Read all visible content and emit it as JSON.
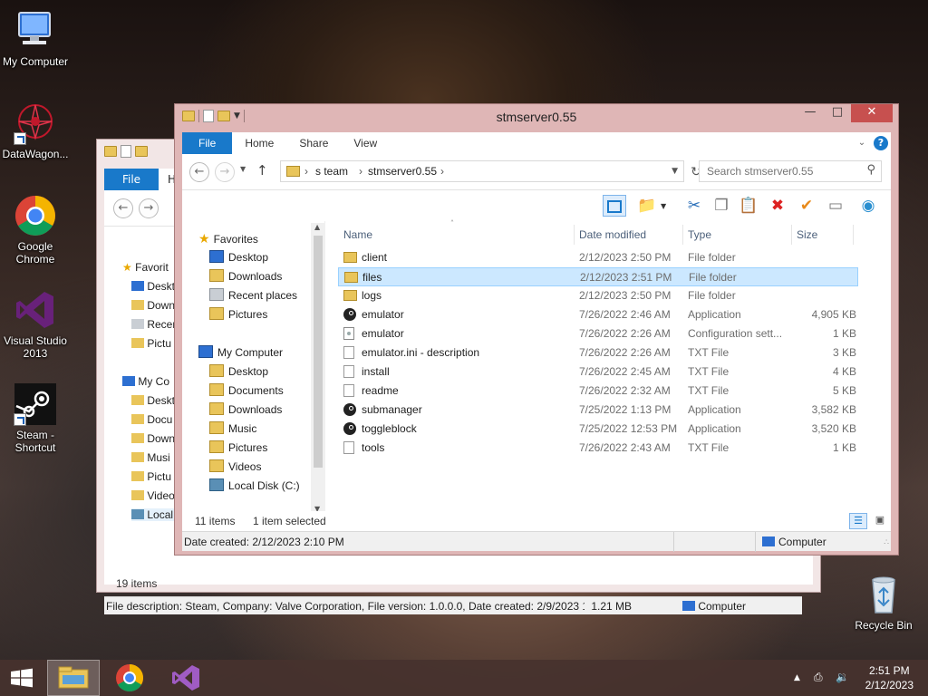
{
  "desktop": {
    "icons": [
      {
        "label": "My Computer"
      },
      {
        "label": "DataWagon..."
      },
      {
        "label": "Google Chrome"
      },
      {
        "label": "Visual Studio 2013"
      },
      {
        "label": "Steam - Shortcut"
      },
      {
        "label": "Recycle Bin"
      }
    ]
  },
  "back_window": {
    "tab_file": "File",
    "tab_home": "H",
    "nav": [
      "Favorit",
      "Deskt",
      "Down",
      "Recen",
      "Pictu",
      "My Co",
      "Deskt",
      "Docu",
      "Down",
      "Musi",
      "Pictu",
      "Video",
      "Local"
    ],
    "status": "19 items",
    "status_hidden": "1 item selected  1.21 MB",
    "detail": "File description: Steam, Company: Valve Corporation, File version: 1.0.0.0, Date created: 2/9/2023 12:08 PM",
    "detail_size": "1.21 MB",
    "detail_computer": "Computer"
  },
  "window": {
    "title": "stmserver0.55",
    "tabs": {
      "file": "File",
      "home": "Home",
      "share": "Share",
      "view": "View"
    },
    "address": {
      "crumb1": "s team",
      "crumb2": "stmserver0.55"
    },
    "search": {
      "placeholder": "Search stmserver0.55"
    },
    "navpane": {
      "favorites": "Favorites",
      "desktop": "Desktop",
      "downloads": "Downloads",
      "recent": "Recent places",
      "pictures": "Pictures",
      "my_computer": "My Computer",
      "mc_desktop": "Desktop",
      "mc_documents": "Documents",
      "mc_downloads": "Downloads",
      "mc_music": "Music",
      "mc_pictures": "Pictures",
      "mc_videos": "Videos",
      "local_disk": "Local Disk (C:)"
    },
    "columns": {
      "name": "Name",
      "date": "Date modified",
      "type": "Type",
      "size": "Size"
    },
    "files": [
      {
        "name": "client",
        "date": "2/12/2023 2:50 PM",
        "type": "File folder",
        "size": "",
        "icon": "folder-icon"
      },
      {
        "name": "files",
        "date": "2/12/2023 2:51 PM",
        "type": "File folder",
        "size": "",
        "icon": "folder-icon"
      },
      {
        "name": "logs",
        "date": "2/12/2023 2:50 PM",
        "type": "File folder",
        "size": "",
        "icon": "folder-icon"
      },
      {
        "name": "emulator",
        "date": "7/26/2022 2:46 AM",
        "type": "Application",
        "size": "4,905 KB",
        "icon": "steam-app-icon"
      },
      {
        "name": "emulator",
        "date": "7/26/2022 2:26 AM",
        "type": "Configuration sett...",
        "size": "1 KB",
        "icon": "config-file-icon"
      },
      {
        "name": "emulator.ini - description",
        "date": "7/26/2022 2:26 AM",
        "type": "TXT File",
        "size": "3 KB",
        "icon": "text-file-icon"
      },
      {
        "name": "install",
        "date": "7/26/2022 2:45 AM",
        "type": "TXT File",
        "size": "4 KB",
        "icon": "text-file-icon"
      },
      {
        "name": "readme",
        "date": "7/26/2022 2:32 AM",
        "type": "TXT File",
        "size": "5 KB",
        "icon": "text-file-icon"
      },
      {
        "name": "submanager",
        "date": "7/25/2022 1:13 PM",
        "type": "Application",
        "size": "3,582 KB",
        "icon": "steam-app-icon"
      },
      {
        "name": "toggleblock",
        "date": "7/25/2022 12:53 PM",
        "type": "Application",
        "size": "3,520 KB",
        "icon": "steam-app-icon"
      },
      {
        "name": "tools",
        "date": "7/26/2022 2:43 AM",
        "type": "TXT File",
        "size": "1 KB",
        "icon": "text-file-icon"
      }
    ],
    "selected_index": 1,
    "status": {
      "count": "11 items",
      "selected": "1 item selected"
    },
    "detail": {
      "text": "Date created: 2/12/2023 2:10 PM",
      "location": "Computer"
    }
  },
  "taskbar": {
    "time": "2:51 PM",
    "date": "2/12/2023"
  },
  "colors": {
    "accent": "#1979ca",
    "selection": "#cce8ff",
    "close": "#c7504f",
    "folder": "#e9c55a"
  }
}
